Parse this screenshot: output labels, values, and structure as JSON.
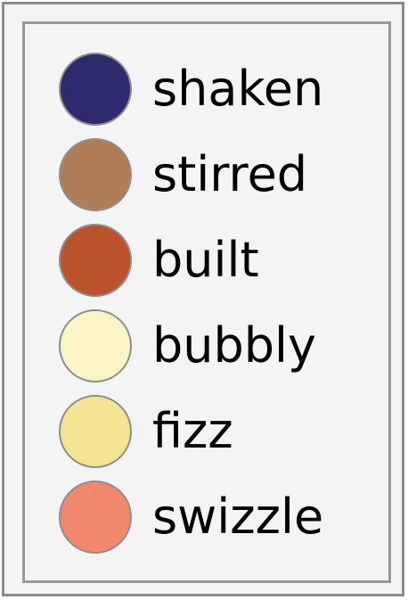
{
  "legend": {
    "items": [
      {
        "label": "shaken",
        "color": "#2d2a6d"
      },
      {
        "label": "stirred",
        "color": "#b07d58"
      },
      {
        "label": "built",
        "color": "#bc532d"
      },
      {
        "label": "bubbly",
        "color": "#fbf4c7"
      },
      {
        "label": "fizz",
        "color": "#f3e493"
      },
      {
        "label": "swizzle",
        "color": "#f3876b"
      }
    ]
  }
}
